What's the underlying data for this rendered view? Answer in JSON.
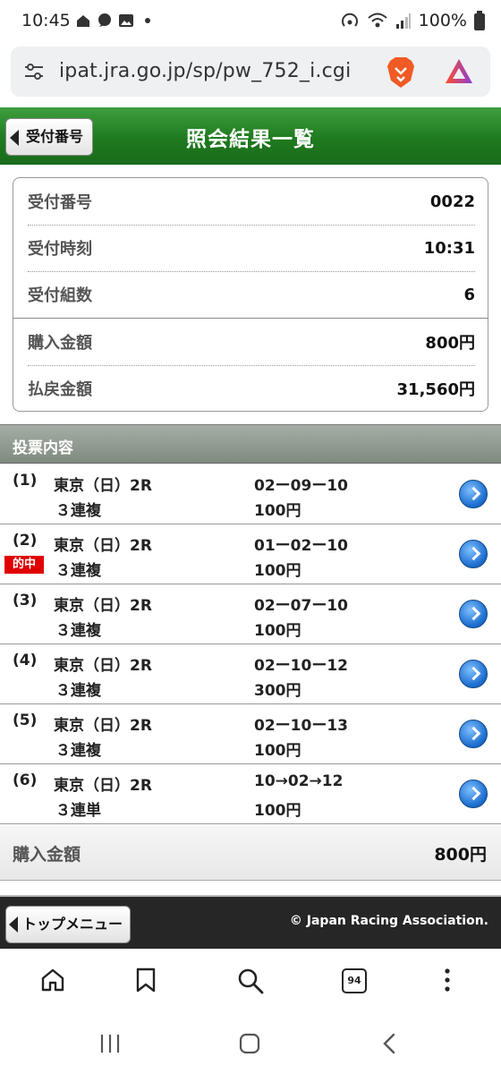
{
  "status_bar": {
    "time": "10:45",
    "battery": "100%"
  },
  "browser": {
    "url": "ipat.jra.go.jp/sp/pw_752_i.cgi",
    "tab_count": "94"
  },
  "header": {
    "back_label": "受付番号",
    "title": "照会結果一覧"
  },
  "summary": {
    "rows": [
      {
        "label": "受付番号",
        "value": "0022"
      },
      {
        "label": "受付時刻",
        "value": "10:31"
      },
      {
        "label": "受付組数",
        "value": "6"
      },
      {
        "label": "購入金額",
        "value": "800円"
      },
      {
        "label": "払戻金額",
        "value": "31,560円"
      }
    ]
  },
  "bets_section": {
    "title": "投票内容"
  },
  "bets": [
    {
      "num": "(1)",
      "race": "東京（日）2R",
      "type": "３連複",
      "combo": "02ー09ー10",
      "amount": "100円",
      "hit": ""
    },
    {
      "num": "(2)",
      "race": "東京（日）2R",
      "type": "３連複",
      "combo": "01ー02ー10",
      "amount": "100円",
      "hit": "的中"
    },
    {
      "num": "(3)",
      "race": "東京（日）2R",
      "type": "３連複",
      "combo": "02ー07ー10",
      "amount": "100円",
      "hit": ""
    },
    {
      "num": "(4)",
      "race": "東京（日）2R",
      "type": "３連複",
      "combo": "02ー10ー12",
      "amount": "300円",
      "hit": ""
    },
    {
      "num": "(5)",
      "race": "東京（日）2R",
      "type": "３連複",
      "combo": "02ー10ー13",
      "amount": "100円",
      "hit": ""
    },
    {
      "num": "(6)",
      "race": "東京（日）2R",
      "type": "３連単",
      "combo": "10→02→12",
      "amount": "100円",
      "hit": ""
    }
  ],
  "total": {
    "label": "購入金額",
    "value": "800円"
  },
  "footer": {
    "top_menu_label": "トップメニュー",
    "copyright": "© Japan Racing Association."
  },
  "colors": {
    "header_green": "#1f7a1f",
    "hit_red": "#e00000",
    "arrow_blue": "#1e6fd0"
  }
}
